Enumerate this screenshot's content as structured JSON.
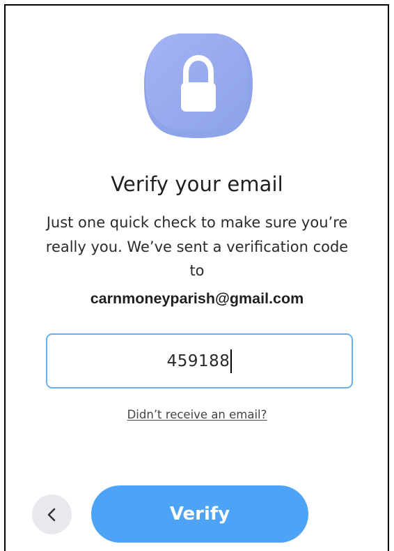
{
  "icons": {
    "lock": "lock-icon",
    "back": "chevron-left-icon"
  },
  "colors": {
    "accent": "#4da3f5",
    "lock_badge": "#9aaef0",
    "input_border": "#6aaef0"
  },
  "heading": {
    "title": "Verify your email",
    "description": "Just one quick check to make sure you’re really you. We’ve sent a verification code to",
    "email": "carnmoneyparish@gmail.com"
  },
  "code_input": {
    "value": "459188"
  },
  "resend_link": "Didn’t receive an email?",
  "actions": {
    "verify_label": "Verify"
  }
}
